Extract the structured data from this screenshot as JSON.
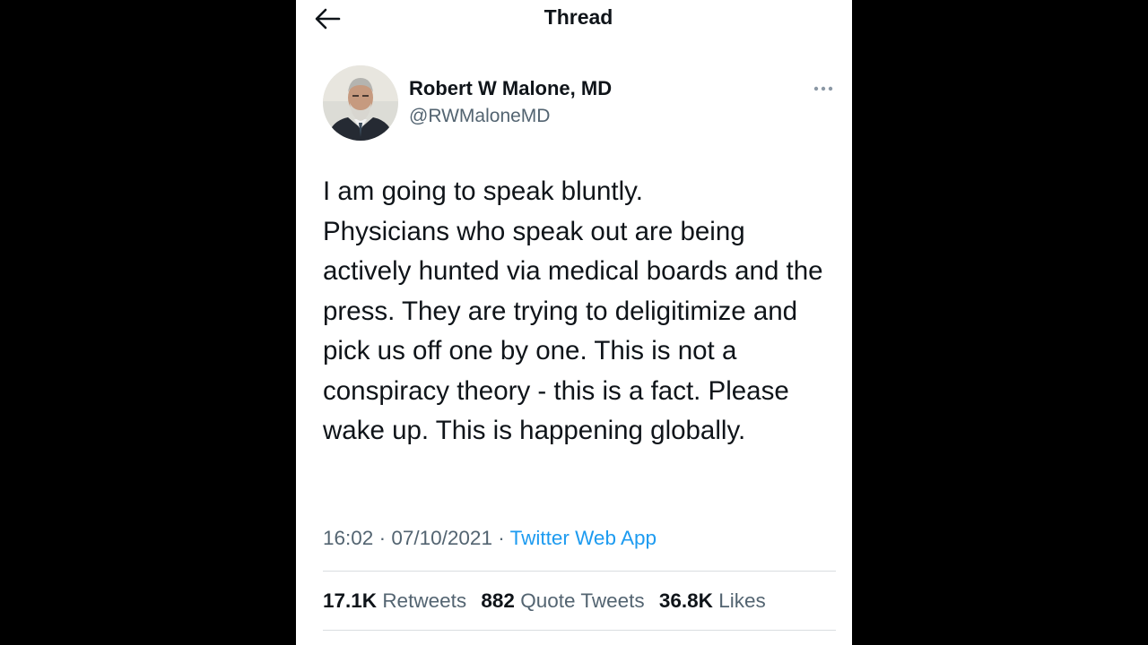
{
  "header": {
    "back_icon": "arrow-left-icon",
    "title": "Thread"
  },
  "tweet": {
    "author": {
      "name": "Robert W Malone, MD",
      "handle": "@RWMaloneMD",
      "avatar": "profile-photo"
    },
    "more_icon": "ellipsis-icon",
    "text": "I am going to speak bluntly.\nPhysicians who speak out are being actively hunted via medical boards and the press.  They are trying to deligitimize and pick us off one by one.  This is not a conspiracy theory - this is a fact. Please wake up. This is happening globally.",
    "time": "16:02",
    "date": "07/10/2021",
    "separator": "·",
    "source": "Twitter Web App",
    "stats": {
      "retweets_count": "17.1K",
      "retweets_label": "Retweets",
      "quotes_count": "882",
      "quotes_label": "Quote Tweets",
      "likes_count": "36.8K",
      "likes_label": "Likes"
    }
  },
  "colors": {
    "background_outer": "#000000",
    "background": "#ffffff",
    "text_primary": "#0f1419",
    "text_secondary": "#536471",
    "link": "#1d9bf0",
    "divider": "#d9dde0"
  }
}
